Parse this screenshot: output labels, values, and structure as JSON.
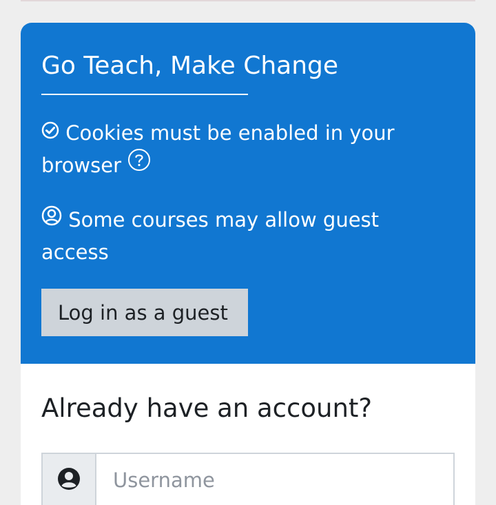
{
  "hero": {
    "title": "Go Teach, Make Change",
    "cookies_text": "Cookies must be enabled in your browser",
    "guest_text": "Some courses may allow guest access",
    "guest_button": "Log in as a guest"
  },
  "login": {
    "title": "Already have an account?",
    "username_placeholder": "Username"
  },
  "icons": {
    "cookies": "check-circle-icon",
    "help": "question-circle-icon",
    "guest": "user-circle-icon",
    "username": "user-icon"
  },
  "colors": {
    "hero_background": "#1177d1",
    "button_background": "#ced4da",
    "text_dark": "#1d2125",
    "input_border": "#ced4da"
  }
}
